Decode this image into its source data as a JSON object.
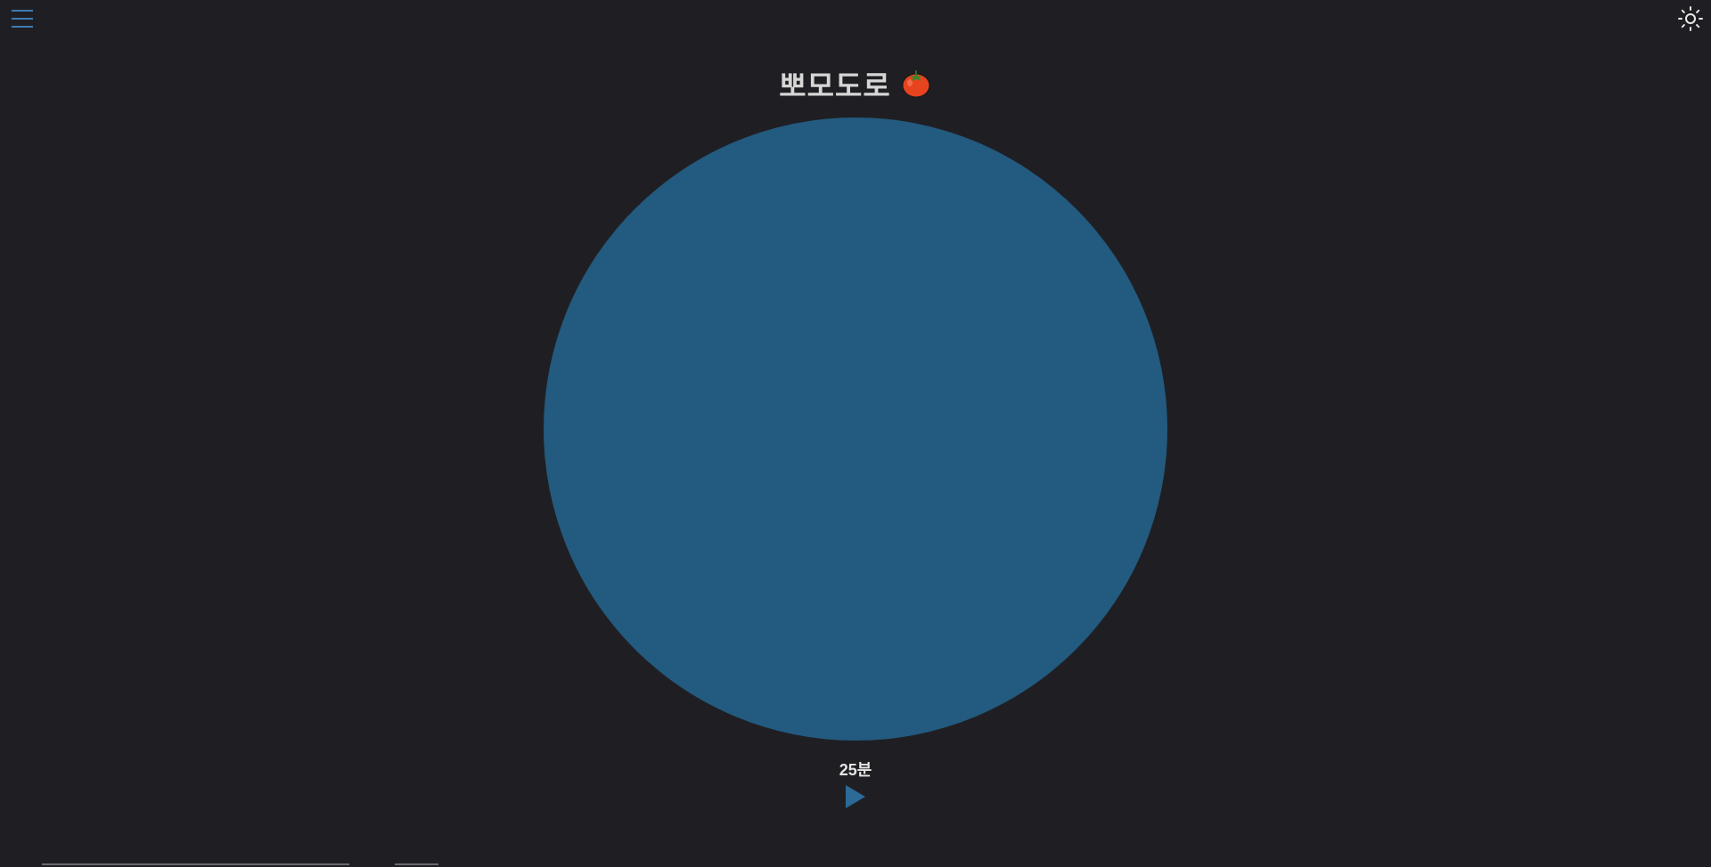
{
  "header": {
    "menu_icon": "hamburger-menu-icon",
    "theme_icon": "sun-icon",
    "title": "뽀모도로",
    "title_icon": "tomato-icon"
  },
  "timer": {
    "duration_label": "25분",
    "play_icon": "play-icon",
    "circle_color": "#235a7f",
    "accent_color": "#3a7ab0"
  }
}
